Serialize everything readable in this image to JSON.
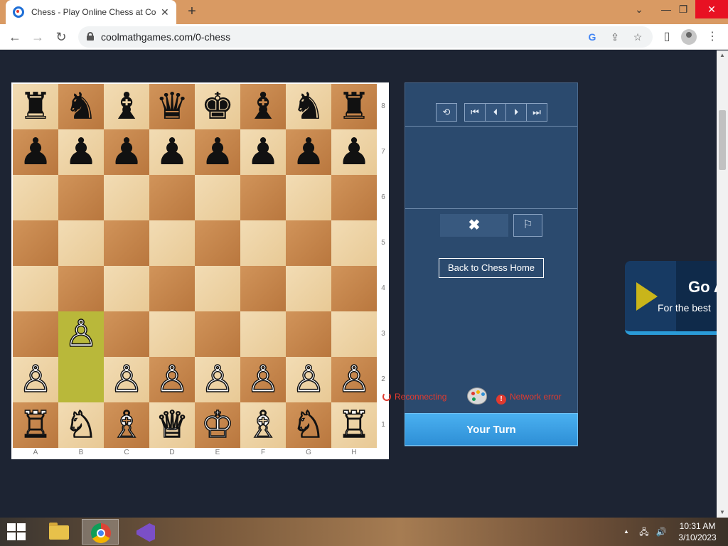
{
  "browser": {
    "tab_title": "Chess - Play Online Chess at Coolmath Games",
    "tab_close": "✕",
    "new_tab": "+",
    "url": "coolmathgames.com/0-chess",
    "window_controls": {
      "minimize": "—",
      "restore": "❐",
      "close": "✕",
      "chevron": "⌄"
    },
    "nav": {
      "back": "←",
      "forward": "→",
      "reload": "↻"
    },
    "icons": {
      "google": "G",
      "share": "⇪",
      "star": "☆",
      "sidebar": "▯",
      "menu": "⋮"
    }
  },
  "board": {
    "squares": [
      [
        "♜",
        "♞",
        "♝",
        "♛",
        "♚",
        "♝",
        "♞",
        "♜"
      ],
      [
        "♟",
        "♟",
        "♟",
        "♟",
        "♟",
        "♟",
        "♟",
        "♟"
      ],
      [
        "",
        "",
        "",
        "",
        "",
        "",
        "",
        ""
      ],
      [
        "",
        "",
        "",
        "",
        "",
        "",
        "",
        ""
      ],
      [
        "",
        "",
        "",
        "",
        "",
        "",
        "",
        ""
      ],
      [
        "",
        "♙",
        "",
        "",
        "",
        "",
        "",
        ""
      ],
      [
        "♙",
        "",
        "♙",
        "♙",
        "♙",
        "♙",
        "♙",
        "♙"
      ],
      [
        "♖",
        "♘",
        "♗",
        "♕",
        "♔",
        "♗",
        "♘",
        "♖"
      ]
    ],
    "highlighted": [
      "b3",
      "b2"
    ],
    "ranks": [
      "8",
      "7",
      "6",
      "5",
      "4",
      "3",
      "2",
      "1"
    ],
    "files": [
      "A",
      "B",
      "C",
      "D",
      "E",
      "F",
      "G",
      "H"
    ]
  },
  "panel": {
    "controls": {
      "flip": "⟲",
      "first": "⏮",
      "prev": "⏴",
      "next": "⏵",
      "last": "⏭"
    },
    "cancel": "✖",
    "flag": "⚐",
    "home_button": "Back to Chess Home",
    "reconnecting": "Reconnecting",
    "network_error": "Network error",
    "error_icon": "!",
    "turn": "Your Turn"
  },
  "ad": {
    "title": "Go A",
    "subtitle": "For the best"
  },
  "taskbar": {
    "tray_up": "▲",
    "network": "🖧",
    "volume": "🔊",
    "time": "10:31 AM",
    "date": "3/10/2023"
  },
  "colors": {
    "page_bg": "#1d2433",
    "panel_bg": "#2b4a6e",
    "turn_bar": "#3a9fe4",
    "highlight": "#b9b83a",
    "error": "#e03a2f"
  }
}
